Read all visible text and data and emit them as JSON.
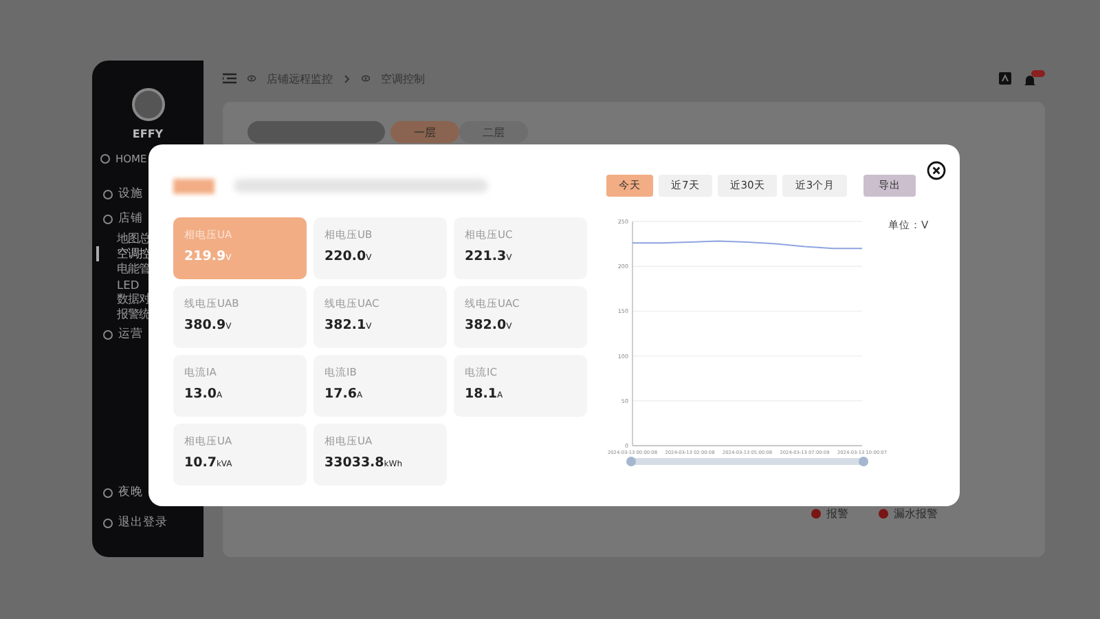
{
  "sidebar": {
    "user": {
      "name": "EFFY"
    },
    "items": [
      {
        "label": "HOME",
        "kind": "top",
        "selected": false
      },
      {
        "label": "设施",
        "kind": "group",
        "selected": false
      },
      {
        "label": "店铺",
        "kind": "group",
        "selected": false
      },
      {
        "label": "地图总",
        "kind": "sub",
        "selected": false
      },
      {
        "label": "空调控",
        "kind": "sub",
        "selected": true
      },
      {
        "label": "电能管",
        "kind": "sub",
        "selected": false
      },
      {
        "label": "LED",
        "kind": "sub",
        "selected": false
      },
      {
        "label": "数据对",
        "kind": "sub",
        "selected": false
      },
      {
        "label": "报警统",
        "kind": "sub",
        "selected": false
      },
      {
        "label": "运营",
        "kind": "group",
        "selected": false
      }
    ],
    "bottom": [
      {
        "label": "夜晚"
      },
      {
        "label": "退出登录"
      }
    ]
  },
  "breadcrumb": [
    "店铺远程监控",
    "空调控制"
  ],
  "floors": [
    {
      "label": "一层",
      "selected": true
    },
    {
      "label": "二层",
      "selected": false
    }
  ],
  "legend": [
    {
      "label": "报警"
    },
    {
      "label": "漏水报警"
    }
  ],
  "modal": {
    "cards": [
      {
        "label": "相电压UA",
        "value": "219.9",
        "unit": "V",
        "selected": true
      },
      {
        "label": "相电压UB",
        "value": "220.0",
        "unit": "V",
        "selected": false
      },
      {
        "label": "相电压UC",
        "value": "221.3",
        "unit": "V",
        "selected": false
      },
      {
        "label": "线电压UAB",
        "value": "380.9",
        "unit": "V",
        "selected": false
      },
      {
        "label": "线电压UAC",
        "value": "382.1",
        "unit": "V",
        "selected": false
      },
      {
        "label": "线电压UAC",
        "value": "382.0",
        "unit": "V",
        "selected": false
      },
      {
        "label": "电流IA",
        "value": "13.0",
        "unit": "A",
        "selected": false
      },
      {
        "label": "电流IB",
        "value": "17.6",
        "unit": "A",
        "selected": false
      },
      {
        "label": "电流IC",
        "value": "18.1",
        "unit": "A",
        "selected": false
      },
      {
        "label": "相电压UA",
        "value": "10.7",
        "unit": "kVA",
        "selected": false
      },
      {
        "label": "相电压UA",
        "value": "33033.8",
        "unit": "kWh",
        "selected": false
      }
    ],
    "ranges": [
      {
        "label": "今天",
        "selected": true
      },
      {
        "label": "近7天",
        "selected": false
      },
      {
        "label": "近30天",
        "selected": false
      },
      {
        "label": "近3个月",
        "selected": false
      }
    ],
    "export_label": "导出",
    "unit_label": "单位：V",
    "chart_data": {
      "type": "line",
      "categories": [
        "2024-03-13 00:00:08",
        null,
        "2024-03-13 02:00:08",
        null,
        "2024-03-13 05:00:08",
        null,
        "2024-03-13 07:00:09",
        null,
        "2024-03-13 10:00:07"
      ],
      "series": [
        {
          "color": "#8fa3e0",
          "values": [
            226,
            226,
            227,
            228,
            227,
            225,
            222,
            220,
            220
          ]
        }
      ],
      "ylim": [
        0,
        250
      ],
      "yticks": [
        0,
        50,
        100,
        150,
        200,
        250
      ],
      "grid": true
    }
  }
}
